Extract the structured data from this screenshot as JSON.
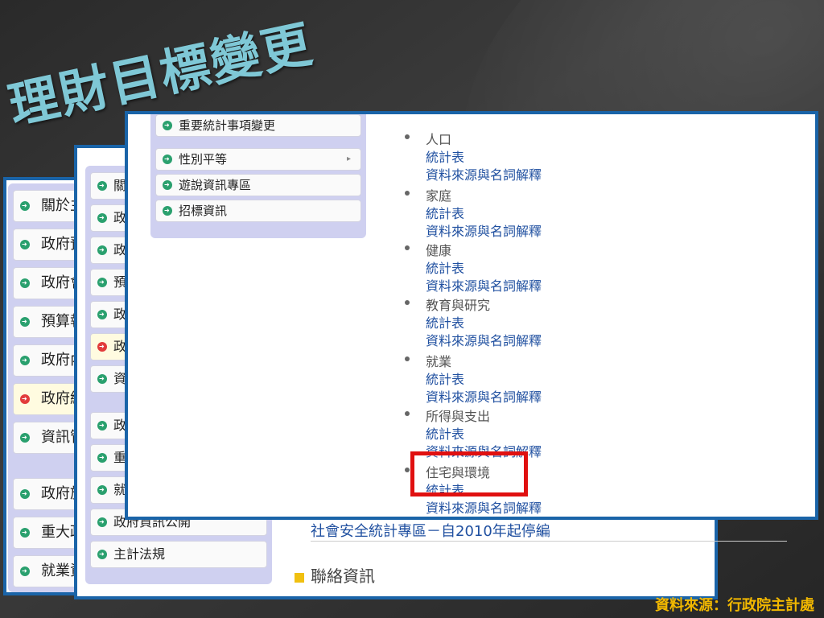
{
  "title": "理財目標變更",
  "source": "資料來源：行政院主計處",
  "screen1": {
    "items": [
      {
        "label": "關於主"
      },
      {
        "label": "政府預"
      },
      {
        "label": "政府會"
      },
      {
        "label": "預算執"
      },
      {
        "label": "政府內"
      },
      {
        "label": "政府統",
        "highlight": true
      },
      {
        "label": "資訊管"
      },
      {
        "label": "政府施"
      },
      {
        "label": "重大政"
      },
      {
        "label": "就業資訊"
      }
    ]
  },
  "screen2": {
    "items": [
      {
        "label": "關"
      },
      {
        "label": "政"
      },
      {
        "label": "政"
      },
      {
        "label": "預"
      },
      {
        "label": "政"
      },
      {
        "label": "政",
        "highlight": true
      },
      {
        "label": "資"
      },
      {
        "label": "政"
      },
      {
        "label": "重"
      },
      {
        "label": "就"
      },
      {
        "label": "政府資訊公開"
      },
      {
        "label": "主計法規"
      }
    ],
    "contact": "聯絡資訊",
    "extra_link": "社會安全統計專區－自2010年起停編"
  },
  "screen3": {
    "nav": [
      {
        "label": "重要統計事項變更"
      },
      {
        "label": "性別平等",
        "submenu": true
      },
      {
        "label": "遊說資訊專區"
      },
      {
        "label": "招標資訊"
      }
    ],
    "categories": [
      {
        "name": "人口",
        "links": [
          "統計表",
          "資料來源與名詞解釋"
        ]
      },
      {
        "name": "家庭",
        "links": [
          "統計表",
          "資料來源與名詞解釋"
        ]
      },
      {
        "name": "健康",
        "links": [
          "統計表",
          "資料來源與名詞解釋"
        ]
      },
      {
        "name": "教育與研究",
        "links": [
          "統計表",
          "資料來源與名詞解釋"
        ]
      },
      {
        "name": "就業",
        "links": [
          "統計表",
          "資料來源與名詞解釋"
        ]
      },
      {
        "name": "所得與支出",
        "links": [
          "統計表",
          "資料來源與名詞解釋"
        ]
      },
      {
        "name": "住宅與環境",
        "links": [
          "統計表",
          "資料來源與名詞解釋"
        ]
      }
    ]
  },
  "colors": {
    "title": "#7fc8d6",
    "frame_border": "#1a64a8",
    "highlight_box": "#e01010",
    "source_text": "#f2b800",
    "link": "#2050a0"
  }
}
